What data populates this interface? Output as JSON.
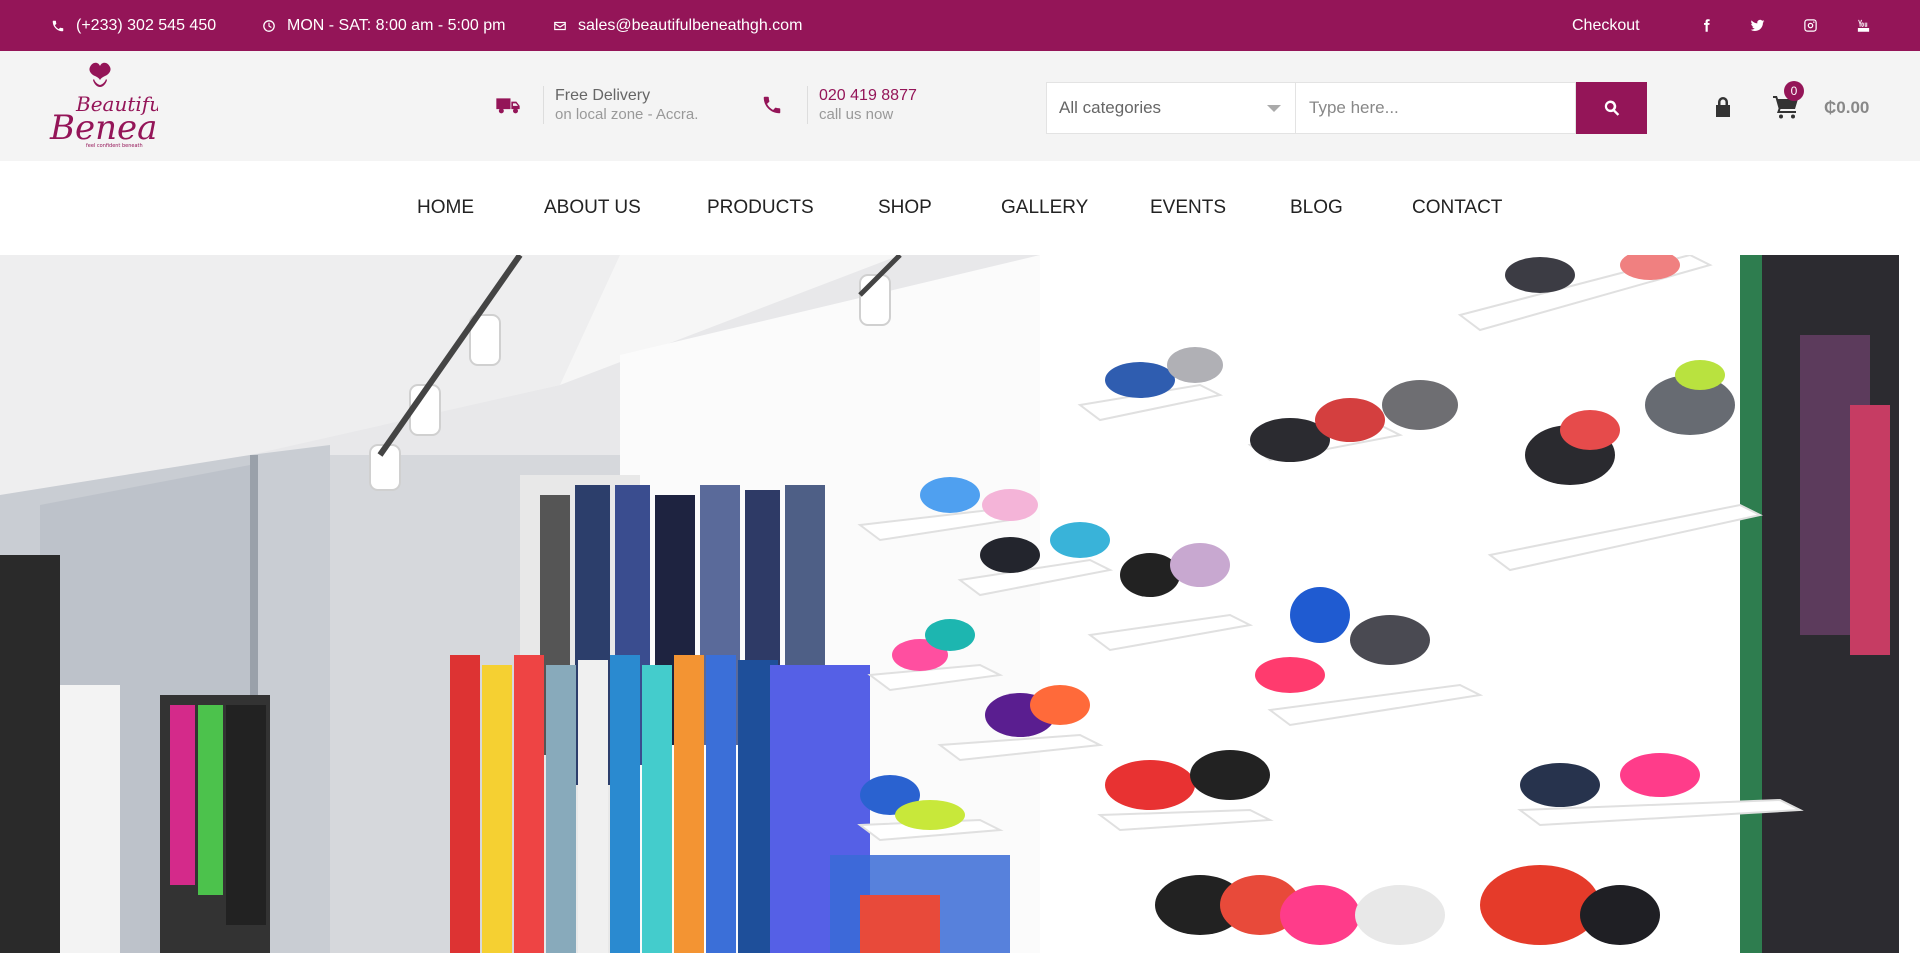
{
  "topbar": {
    "phone": "(+233) 302 545 450",
    "hours": "MON - SAT: 8:00 am - 5:00 pm",
    "email": "sales@beautifulbeneathgh.com",
    "checkout": "Checkout",
    "socials": [
      "facebook-icon",
      "twitter-icon",
      "instagram-icon",
      "youtube-icon"
    ]
  },
  "header": {
    "logo_text": "Beautiful Beneath",
    "logo_tagline": "feel confident beneath",
    "delivery_title": "Free Delivery",
    "delivery_sub": "on local zone - Accra.",
    "phone_title": "020 419 8877",
    "phone_sub": "call us now",
    "category_selected": "All categories",
    "search_placeholder": "Type here...",
    "cart_count": "0",
    "cart_total": "₵0.00"
  },
  "nav": [
    "HOME",
    "ABOUT US",
    "PRODUCTS",
    "SHOP",
    "GALLERY",
    "EVENTS",
    "BLOG",
    "CONTACT"
  ],
  "colors": {
    "brand": "#941558",
    "header_bg": "#f4f4f4"
  }
}
